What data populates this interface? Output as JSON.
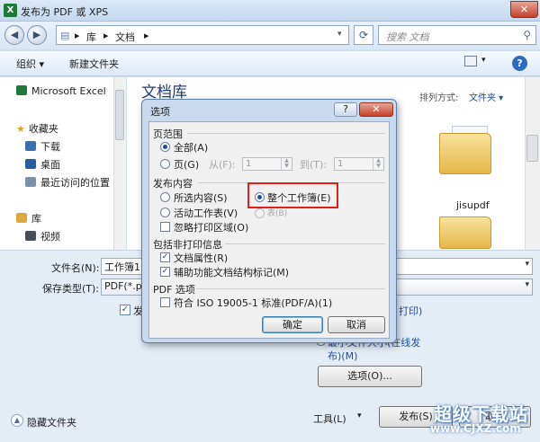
{
  "window": {
    "title": "发布为 PDF 或 XPS",
    "app_icon_glyph": "X",
    "close_glyph": "✕"
  },
  "address": {
    "crumbs": [
      "库",
      "文档"
    ],
    "separator": "▸",
    "search_placeholder": "搜索 文档"
  },
  "toolbar": {
    "organize": "组织 ▾",
    "new_folder": "新建文件夹",
    "help": "?"
  },
  "nav": {
    "items": [
      {
        "label": "Microsoft Excel",
        "icon": "excel-icon"
      },
      {
        "label": "收藏夹",
        "icon": "star-icon"
      },
      {
        "label": "下载",
        "icon": "download-folder-icon"
      },
      {
        "label": "桌面",
        "icon": "desktop-icon"
      },
      {
        "label": "最近访问的位置",
        "icon": "recent-places-icon"
      },
      {
        "label": "库",
        "icon": "library-icon"
      },
      {
        "label": "视频",
        "icon": "video-icon"
      }
    ]
  },
  "main": {
    "library_title": "文档库",
    "sort_label": "排列方式:",
    "sort_value": "文件夹 ▾",
    "folders": [
      {
        "label": "jisupdf"
      }
    ]
  },
  "form": {
    "filename_label": "文件名(N):",
    "filename_value": "工作簿1.p",
    "filetype_label": "保存类型(T):",
    "filetype_value": "PDF(*.pdf",
    "open_after_fragment": "发",
    "print_fragment": "打印)",
    "publish_min_fragment": "最小文件大小(在线发",
    "publish_min_fragment2": "布)(M)",
    "options_button": "选项(O)...",
    "hide_folders": "隐藏文件夹",
    "tools": "工具(L)",
    "publish_button": "发布(S)",
    "cancel_button": "取消"
  },
  "options_dialog": {
    "title": "选项",
    "help": "?",
    "close": "✕",
    "page_range": {
      "title": "页范围",
      "all": "全部(A)",
      "pages": "页(G)",
      "from_label": "从(F):",
      "from_value": "1",
      "to_label": "到(T):",
      "to_value": "1"
    },
    "publish_what": {
      "title": "发布内容",
      "selection": "所选内容(S)",
      "entire_workbook": "整个工作簿(E)",
      "active_sheets": "活动工作表(V)",
      "table": "表(B)",
      "ignore_print_areas": "忽略打印区域(O)"
    },
    "include_non_printing": {
      "title": "包括非打印信息",
      "document_properties": "文档属性(R)",
      "accessibility_tags": "辅助功能文档结构标记(M)",
      "document_properties_checked": true,
      "accessibility_tags_checked": true
    },
    "pdf_options": {
      "title": "PDF 选项",
      "iso_compliant": "符合 ISO 19005-1 标准(PDF/A)(1)"
    },
    "ok": "确定",
    "cancel": "取消"
  },
  "watermark": {
    "brand": "超级下载站",
    "url": "www.CJXZ.com"
  },
  "colors": {
    "highlight": "#e41c1c",
    "link": "#1c4fa3",
    "title_blue": "#1e3c78"
  }
}
